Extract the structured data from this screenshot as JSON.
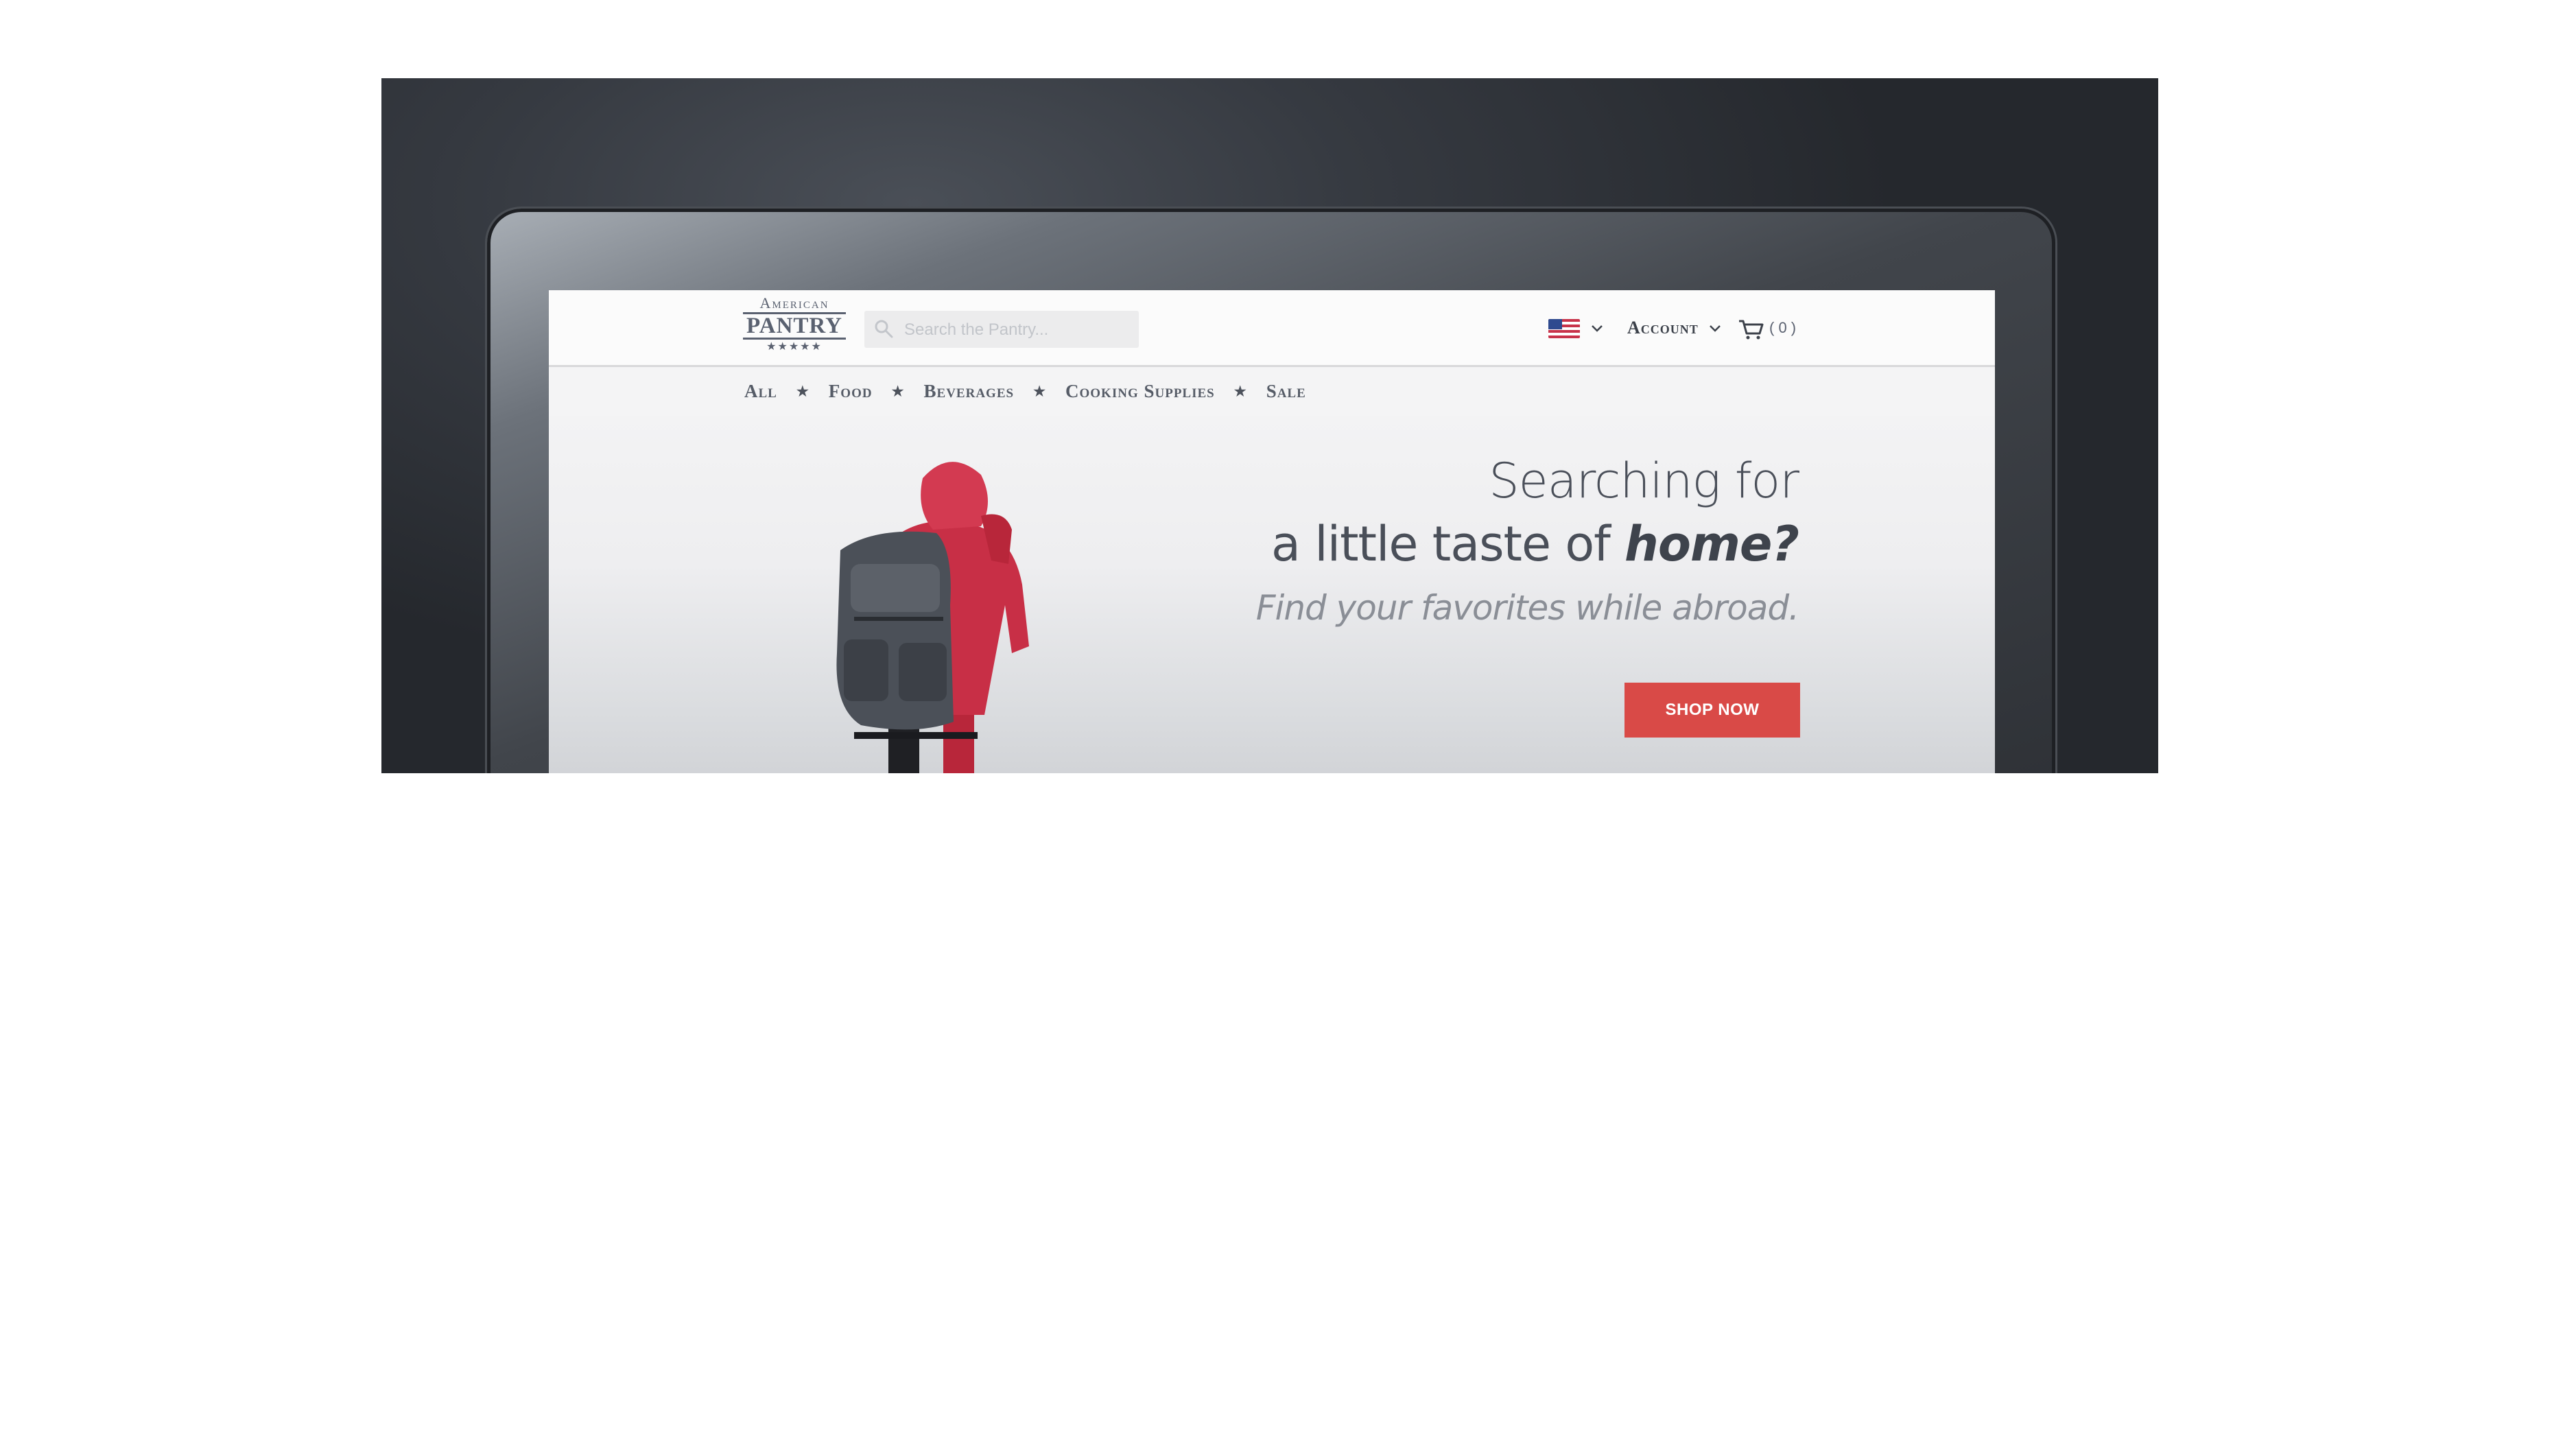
{
  "header": {
    "logo": {
      "top": "American",
      "main": "PANTRY",
      "stars": "★★★★★"
    },
    "search": {
      "placeholder": "Search the Pantry..."
    },
    "account_label": "Account",
    "cart_count": "( 0 )"
  },
  "nav": {
    "items": [
      "All",
      "Food",
      "Beverages",
      "Cooking Supplies",
      "Sale"
    ],
    "separator": "★"
  },
  "hero": {
    "line1": "Searching for",
    "line2_prefix": "a little taste of ",
    "line2_emph": "home?",
    "subline": "Find your favorites while abroad.",
    "button_label": "SHOP NOW"
  },
  "colors": {
    "accent": "#d94a47",
    "text_dark": "#4a4f59",
    "text_muted": "#8a8e96"
  },
  "icons": [
    "search-icon",
    "flag-icon",
    "chevron-down-icon",
    "cart-icon"
  ]
}
